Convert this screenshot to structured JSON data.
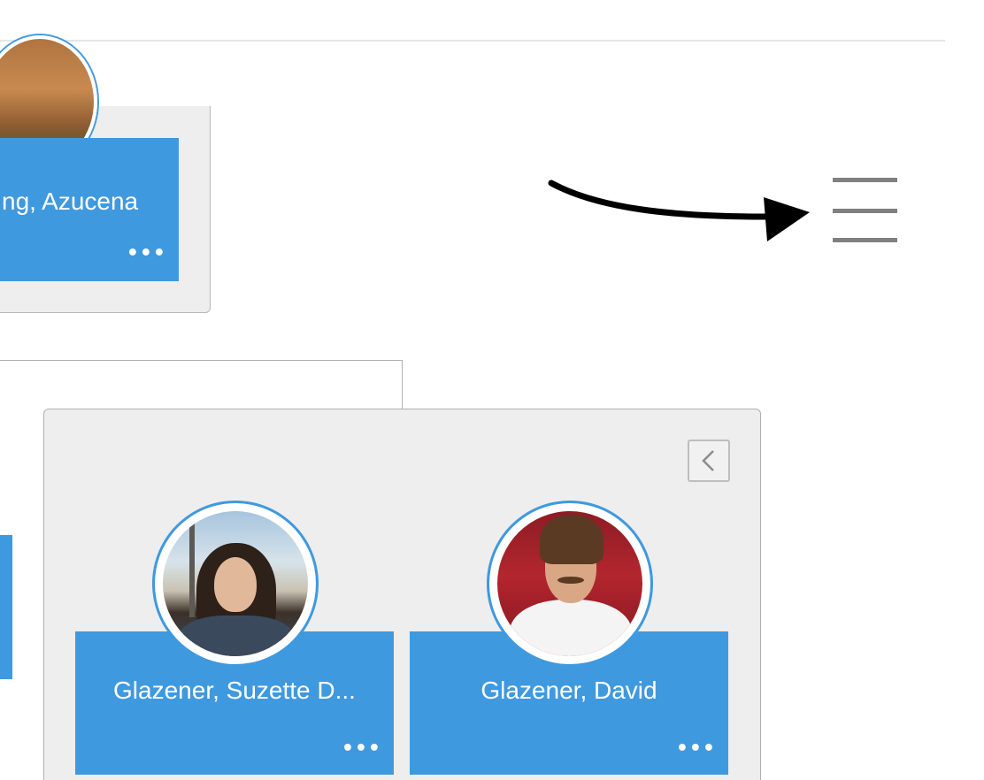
{
  "top_card": {
    "name": "ng, Azucena",
    "more": "•••"
  },
  "menu": {
    "icon": "hamburger-menu-icon"
  },
  "annotation": {
    "icon": "arrow-right-icon"
  },
  "group": {
    "collapse_icon": "chevron-left-icon",
    "people": [
      {
        "name": "Glazener, Suzette D...",
        "more": "•••"
      },
      {
        "name": "Glazener, David",
        "more": "•••"
      }
    ]
  },
  "colors": {
    "card_blue": "#3f99df",
    "card_bg": "#eeeeee",
    "menu_gray": "#808080"
  }
}
